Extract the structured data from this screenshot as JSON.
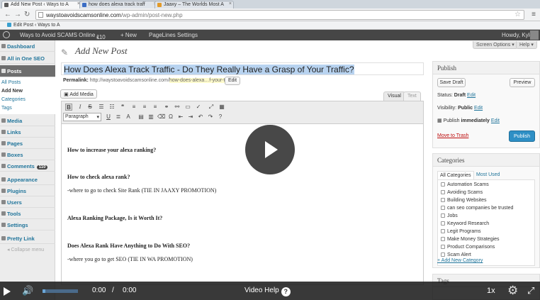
{
  "browser": {
    "tabs": [
      {
        "title": "Add New Post ‹ Ways to A",
        "favicon_color": "#5b5b5b"
      },
      {
        "title": "how does alexa track traff",
        "favicon_color": "#3b6dc4"
      },
      {
        "title": "Jaaxy – The Worlds Most A",
        "favicon_color": "#e29a2a"
      }
    ],
    "address_host": "waystoavoidscamsonline.com",
    "address_path": "/wp-admin/post-new.php",
    "bookmark": "Edit Post ‹ Ways to A"
  },
  "adminbar": {
    "site": "Ways to Avoid SCAMS Online",
    "comments": "110",
    "new": "+ New",
    "plugin": "PageLines Settings",
    "greeting": "Howdy, Kyle"
  },
  "menu": {
    "items": [
      {
        "label": "Dashboard"
      },
      {
        "label": "All in One SEO"
      },
      {
        "label": "Posts"
      },
      {
        "label": "Media"
      },
      {
        "label": "Links"
      },
      {
        "label": "Pages"
      },
      {
        "label": "Boxes"
      },
      {
        "label": "Comments",
        "badge": "110"
      },
      {
        "label": "Appearance"
      },
      {
        "label": "Plugins"
      },
      {
        "label": "Users"
      },
      {
        "label": "Tools"
      },
      {
        "label": "Settings"
      },
      {
        "label": "Pretty Link"
      }
    ],
    "sub": [
      "All Posts",
      "Add New",
      "Categories",
      "Tags"
    ],
    "collapse": "Collapse menu"
  },
  "page": {
    "title": "Add New Post",
    "screen_options": "Screen Options ▾",
    "help": "Help ▾",
    "post_title": "How Does Alexa Track Traffic - Do They Really Have a Grasp of Your Traffic?",
    "permalink_label": "Permalink:",
    "permalink_base": "http://waystoavoidscamsonline.com/",
    "permalink_slug": "how-does-alexa…f-your-traffic",
    "edit_btn": "Edit",
    "add_media": "Add Media",
    "tab_visual": "Visual",
    "tab_text": "Text",
    "format_select": "Paragraph"
  },
  "content": [
    {
      "text": "How to increase your alexa ranking?",
      "bold": true
    },
    {
      "text": "How to check alexa rank?",
      "bold": true
    },
    {
      "text": "-where to go to check Site Rank (TIE IN JAAXY PROMOTION)",
      "bold": false
    },
    {
      "text": "Alexa Ranking Package, Is it Worth It?",
      "bold": true
    },
    {
      "text": "Does Alexa Rank Have Anything to Do With SEO?",
      "bold": true
    },
    {
      "text": "-where you go to get SEO (TIE IN WA PROMOTION)",
      "bold": false
    }
  ],
  "publish": {
    "heading": "Publish",
    "save_draft": "Save Draft",
    "preview": "Preview",
    "status_label": "Status:",
    "status_value": "Draft",
    "visibility_label": "Visibility:",
    "visibility_value": "Public",
    "publish_label": "Publish",
    "publish_value": "immediately",
    "edit": "Edit",
    "trash": "Move to Trash",
    "publish_btn": "Publish"
  },
  "categories": {
    "heading": "Categories",
    "tab_all": "All Categories",
    "tab_used": "Most Used",
    "items": [
      "Automation Scams",
      "Avoiding Scams",
      "Building Websites",
      "can seo companies be trusted",
      "Jobs",
      "Keyword Research",
      "Legit Programs",
      "Make Money Strategies",
      "Product Comparisons",
      "Scam Alert"
    ],
    "add_new": "+ Add New Category"
  },
  "tags_box": {
    "heading": "Tags"
  },
  "video": {
    "current_time": "0:00",
    "separator": "/",
    "duration": "0:00",
    "help": "Video Help",
    "speed": "1x",
    "progress": 0.0
  }
}
